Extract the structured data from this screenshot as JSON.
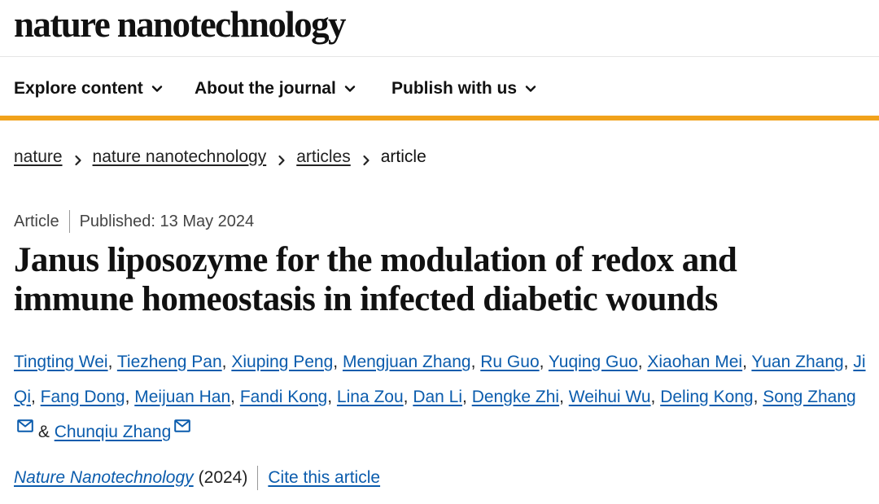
{
  "header": {
    "brand": "nature nanotechnology"
  },
  "nav": {
    "items": [
      {
        "label": "Explore content",
        "icon": "chevron-down-icon"
      },
      {
        "label": "About the journal",
        "icon": "chevron-down-icon"
      },
      {
        "label": "Publish with us",
        "icon": "chevron-down-icon"
      }
    ],
    "accent_color": "#f1a21b"
  },
  "breadcrumb": {
    "items": [
      {
        "label": "nature",
        "link": true
      },
      {
        "label": "nature nanotechnology",
        "link": true
      },
      {
        "label": "articles",
        "link": true
      },
      {
        "label": "article",
        "link": false
      }
    ]
  },
  "article": {
    "type": "Article",
    "published": "Published: 13 May 2024",
    "title": "Janus liposozyme for the modulation of redox and immune homeostasis in infected diabetic wounds",
    "authors": [
      "Tingting Wei",
      "Tiezheng Pan",
      "Xiuping Peng",
      "Mengjuan Zhang",
      "Ru Guo",
      "Yuqing Guo",
      "Xiaohan Mei",
      "Yuan Zhang",
      "Ji Qi",
      "Fang Dong",
      "Meijuan Han",
      "Fandi Kong",
      "Lina Zou",
      "Dan Li",
      "Dengke Zhi",
      "Weihui Wu",
      "Deling Kong",
      "Song Zhang",
      "Chunqiu Zhang"
    ],
    "corresponding_icon": "mail-icon",
    "author_separator": ", ",
    "final_joiner": "&",
    "journal": "Nature Nanotechnology",
    "year": "(2024)",
    "cite_label": "Cite this article",
    "link_color": "#0b5cad"
  }
}
